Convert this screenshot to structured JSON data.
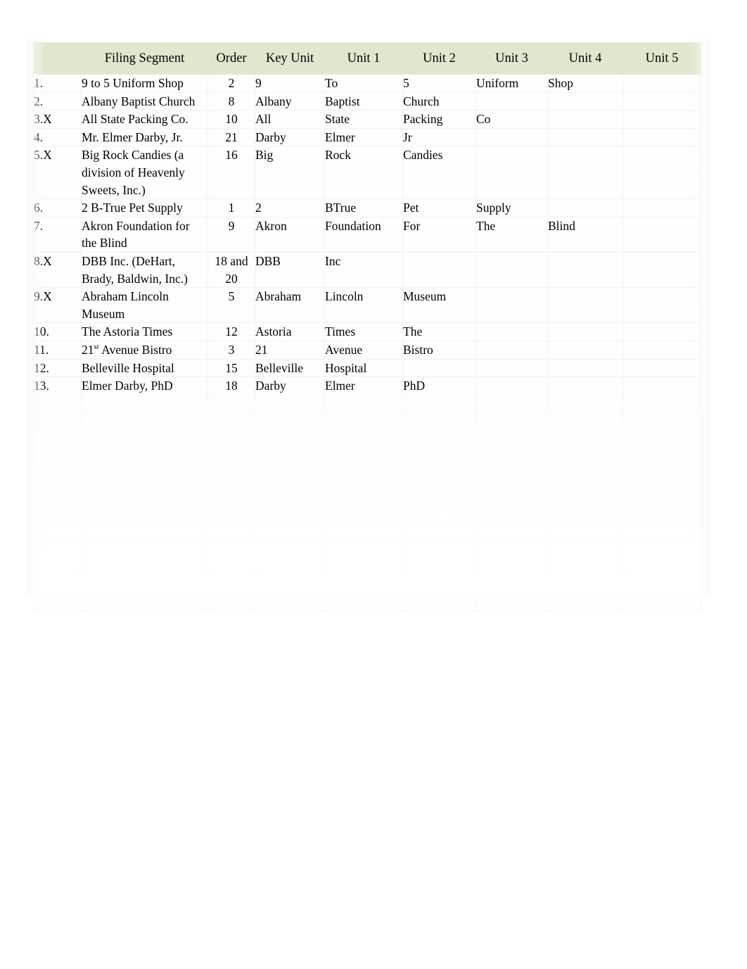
{
  "document": {
    "page_background": "#ffffff",
    "header_background": "#dfe8ce"
  },
  "table": {
    "columns": [
      {
        "key": "num",
        "label": ""
      },
      {
        "key": "segment",
        "label": "Filing Segment"
      },
      {
        "key": "order",
        "label": "Order"
      },
      {
        "key": "key",
        "label": "Key Unit"
      },
      {
        "key": "u1",
        "label": "Unit 1"
      },
      {
        "key": "u2",
        "label": "Unit 2"
      },
      {
        "key": "u3",
        "label": "Unit 3"
      },
      {
        "key": "u4",
        "label": "Unit 4"
      },
      {
        "key": "u5",
        "label": "Unit 5"
      }
    ],
    "headers": {
      "blank": "",
      "filing_segment": "Filing Segment",
      "order": "Order",
      "key_unit": "Key Unit",
      "unit_1": "Unit 1",
      "unit_2": "Unit 2",
      "unit_3": "Unit 3",
      "unit_4": "Unit 4",
      "unit_5": "Unit 5"
    },
    "rows": [
      {
        "num": "1.",
        "segment": "9 to 5 Uniform Shop",
        "order": "2",
        "key": "9",
        "u1": "To",
        "u2": "5",
        "u3": "Uniform",
        "u4": "Shop",
        "u5": ""
      },
      {
        "num": "2.",
        "segment": "Albany Baptist Church",
        "order": "8",
        "key": "Albany",
        "u1": "Baptist",
        "u2": "Church",
        "u3": "",
        "u4": "",
        "u5": ""
      },
      {
        "num": "3.X",
        "segment": "All State Packing Co.",
        "order": "10",
        "key": "All",
        "u1": "State",
        "u2": "Packing",
        "u3": "Co",
        "u4": "",
        "u5": ""
      },
      {
        "num": "4.",
        "segment": "Mr. Elmer Darby, Jr.",
        "order": "21",
        "key": "Darby",
        "u1": "Elmer",
        "u2": "Jr",
        "u3": "",
        "u4": "",
        "u5": ""
      },
      {
        "num": "5.X",
        "segment": "Big Rock Candies (a division of Heavenly Sweets, Inc.)",
        "order": "16",
        "key": "Big",
        "u1": "Rock",
        "u2": "Candies",
        "u3": "",
        "u4": "",
        "u5": ""
      },
      {
        "num": "6.",
        "segment": "2 B-True Pet Supply",
        "order": "1",
        "key": "2",
        "u1": "BTrue",
        "u2": "Pet",
        "u3": "Supply",
        "u4": "",
        "u5": ""
      },
      {
        "num": "7.",
        "segment": "Akron Foundation for the Blind",
        "order": "9",
        "key": "Akron",
        "u1": "Foundation",
        "u2": "For",
        "u3": "The",
        "u4": "Blind",
        "u5": ""
      },
      {
        "num": "8.X",
        "segment": "DBB Inc. (DeHart, Brady, Baldwin, Inc.)",
        "order": "18 and 20",
        "key": "DBB",
        "u1": "Inc",
        "u2": "",
        "u3": "",
        "u4": "",
        "u5": ""
      },
      {
        "num": "9.X",
        "segment": "Abraham Lincoln Museum",
        "order": "5",
        "key": "Abraham",
        "u1": "Lincoln",
        "u2": "Museum",
        "u3": "",
        "u4": "",
        "u5": ""
      },
      {
        "num": "10.",
        "segment": "The Astoria Times",
        "order": "12",
        "key": "Astoria",
        "u1": "Times",
        "u2": "The",
        "u3": "",
        "u4": "",
        "u5": ""
      },
      {
        "num": "11.",
        "segment": "21st Avenue Bistro",
        "segment_superscript": "st",
        "segment_prefix": "21",
        "segment_suffix": " Avenue Bistro",
        "order": "3",
        "key": "21",
        "u1": "Avenue",
        "u2": "Bistro",
        "u3": "",
        "u4": "",
        "u5": ""
      },
      {
        "num": "12.",
        "segment": "Belleville Hospital",
        "order": "15",
        "key": "Belleville",
        "u1": "Hospital",
        "u2": "",
        "u3": "",
        "u4": "",
        "u5": ""
      },
      {
        "num": "13.",
        "segment": "Elmer Darby, PhD",
        "order": "18",
        "key": "Darby",
        "u1": "Elmer",
        "u2": "PhD",
        "u3": "",
        "u4": "",
        "u5": ""
      }
    ],
    "faded_rows_note": "Rows below row 13 are progressively faded out and illegible in the screenshot."
  }
}
